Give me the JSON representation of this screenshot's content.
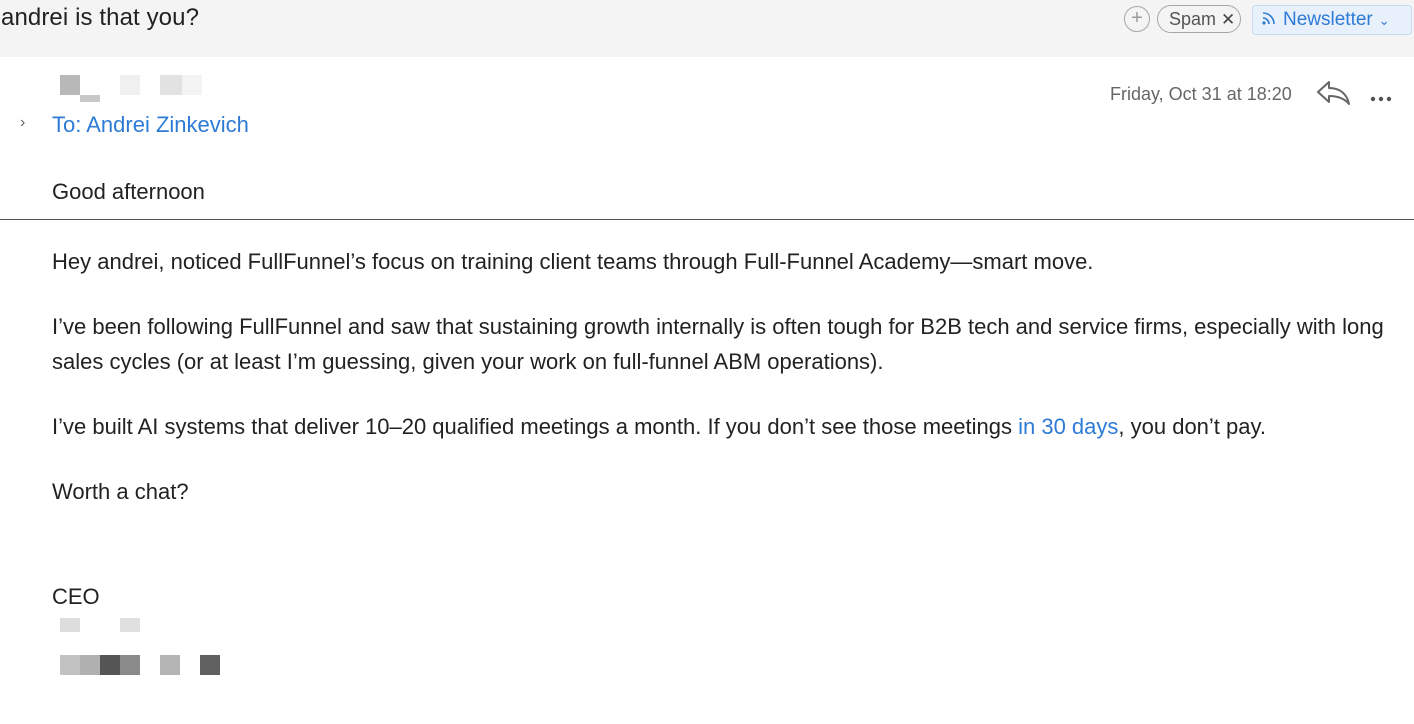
{
  "subject": "andrei is that you?",
  "tags": {
    "add_glyph": "+",
    "spam_label": "Spam",
    "spam_close": "✕",
    "newsletter_label": "Newsletter",
    "newsletter_chevron": "⌄"
  },
  "message": {
    "expand_glyph": "›",
    "to": "To: Andrei Zinkevich",
    "date": "Friday, Oct 31 at 18:20",
    "more_glyph": "•••",
    "greeting": "Good afternoon",
    "paragraphs": [
      "Hey andrei, noticed FullFunnel’s focus on training client teams through Full-Funnel Academy—smart move.",
      "I’ve been following FullFunnel and saw that sustaining growth internally is often tough for B2B tech and service firms, especially with long sales cycles (or at least I’m guessing, given your work on full-funnel ABM operations).",
      "Worth a chat?"
    ],
    "offer": {
      "before": "I’ve built AI systems that deliver 10–20 qualified meetings a month. If you don’t see those meetings ",
      "link": "in 30 days",
      "after": ", you don’t pay."
    },
    "signature_title": "CEO"
  },
  "colors": {
    "accent": "#2d7bd6",
    "background": "#f4f4f4",
    "card": "#ffffff",
    "text": "#222222",
    "muted": "#666666"
  }
}
